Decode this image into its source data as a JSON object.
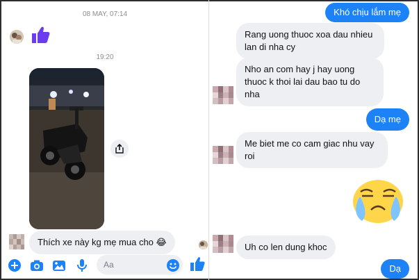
{
  "left_chat": {
    "timestamp_top": "08 MAY, 07:14",
    "timestamp_mid": "19:20",
    "photo_alt": "Motorbike parked at night",
    "received_message": "Thích xe này kg mẹ mua cho 😂",
    "composer": {
      "placeholder": "Aa",
      "icons": [
        "plus-icon",
        "camera-icon",
        "image-icon",
        "microphone-icon",
        "emoji-icon",
        "like-icon"
      ]
    }
  },
  "right_chat": {
    "messages": [
      {
        "dir": "out",
        "text": "Khó chịu lắm mẹ"
      },
      {
        "dir": "in",
        "text": "Rang uong thuoc xoa dau nhieu lan di nha cy"
      },
      {
        "dir": "in",
        "text": "Nho an com hay j hay uong thuoc k thoi lai dau bao tu do nha"
      },
      {
        "dir": "out",
        "text": "Dạ mẹ"
      },
      {
        "dir": "in",
        "text": "Me biet me co cam giac nhu vay roi"
      },
      {
        "dir": "out",
        "text": "😢",
        "kind": "sticker"
      },
      {
        "dir": "in",
        "text": "Uh co len dung khoc"
      },
      {
        "dir": "out",
        "text": "Dạ"
      }
    ]
  },
  "colors": {
    "accent": "#1d82f5",
    "messenger_purple": "#6a3cf0",
    "bubble_gray": "#eeeff2",
    "timestamp": "#8a8d91"
  }
}
